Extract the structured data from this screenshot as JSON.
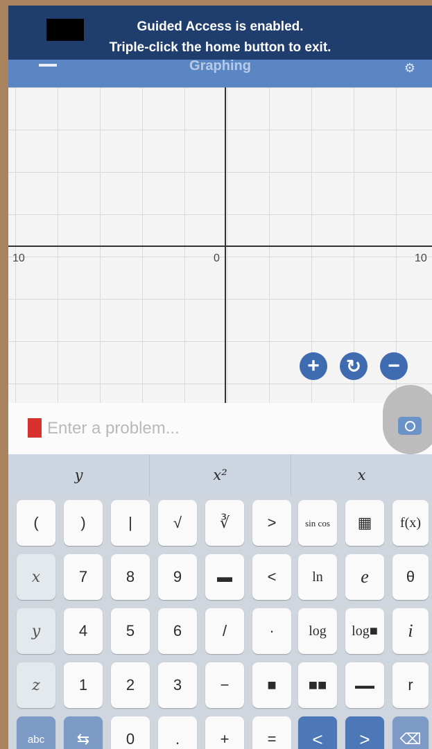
{
  "banner": {
    "line1": "Guided Access is enabled.",
    "line2": "Triple-click the home button to exit."
  },
  "appbar": {
    "title": "Graphing"
  },
  "graph": {
    "tick_left": "10",
    "tick_zero": "0",
    "tick_right": "10",
    "zoom_in": "+",
    "zoom_reset": "↻",
    "zoom_out": "−"
  },
  "input": {
    "placeholder": "Enter a problem..."
  },
  "suggestions": [
    "y",
    "x²",
    "x"
  ],
  "keys": {
    "row1": [
      "(",
      ")",
      "|",
      "√",
      "∛",
      ">",
      "sin cos",
      "▦",
      "f(x)"
    ],
    "row2": [
      "x",
      "7",
      "8",
      "9",
      "▬",
      "<",
      "ln",
      "e",
      "θ"
    ],
    "row3": [
      "y",
      "4",
      "5",
      "6",
      "/",
      "·",
      "log",
      "log■",
      "i"
    ],
    "row4": [
      "z",
      "1",
      "2",
      "3",
      "−",
      "■",
      "■■",
      "▬▬",
      "r"
    ],
    "row5": [
      "abc",
      "⇆",
      "0",
      ".",
      "+",
      "=",
      "<",
      ">",
      "⌫"
    ]
  },
  "colors": {
    "banner": "#1f3e6e",
    "appbar": "#5b86c4",
    "zoom_buttons": "#3f6bb0",
    "cursor": "#d9322e"
  }
}
